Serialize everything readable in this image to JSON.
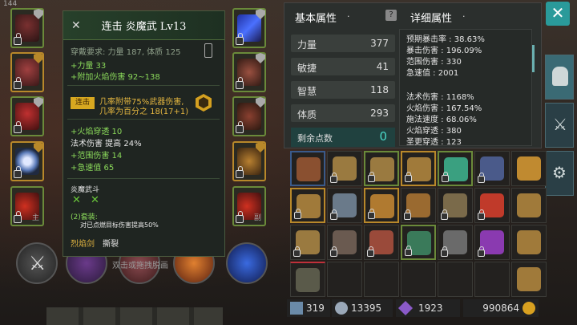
{
  "top_left_number": "144",
  "tooltip": {
    "title": "连击 炎魔武 Lv13",
    "requirement": "穿戴要求:  力量 187, 体质 125",
    "stat1": "+力量 33",
    "stat2": "+附加火焰伤害 92~138",
    "badge": "连击",
    "proc_line1": "几率附带75%武器伤害,",
    "proc_line2": "几率为百分之 18(17+1)",
    "stat3": "+火焰穿透 10",
    "stat4": "法术伤害 提高 24%",
    "stat5": "+范围伤害 14",
    "stat6": "+急速值 65",
    "set_name": "炎魔武斗",
    "set_bonus_title": "(2)套装:",
    "set_bonus_desc": "对已点燃目标伤害提高50%",
    "set_item1": "烈焰剑",
    "set_item2": "撕裂"
  },
  "skill_bar": {
    "hint": "双击或拖拽脱画"
  },
  "slot_labels": {
    "left_bottom": "主",
    "right_bottom": "副"
  },
  "stats": {
    "basic_title": "基本属性",
    "detail_title": "详细属性",
    "rows": [
      {
        "label": "力量",
        "value": "377"
      },
      {
        "label": "敏捷",
        "value": "41"
      },
      {
        "label": "智慧",
        "value": "118"
      },
      {
        "label": "体质",
        "value": "293"
      }
    ],
    "remain_label": "剩余点数",
    "remain_value": "0",
    "details": [
      "预期暴击率 : 38.63%",
      "暴击伤害 : 196.09%",
      "范围伤害 : 330",
      "急速值 : 2001",
      "法术伤害 : 1168%",
      "火焰伤害 : 167.54%",
      "施法速度 : 68.06%",
      "火焰穿透 : 380",
      "圣更穿透 : 123"
    ]
  },
  "currency": {
    "shards": "319",
    "souls": "13395",
    "gems": "1923",
    "gold": "990864"
  },
  "colors": {
    "green_border": "#6a8a3a",
    "gold_border": "#b8882a",
    "accent_teal": "#2a9a9a"
  }
}
